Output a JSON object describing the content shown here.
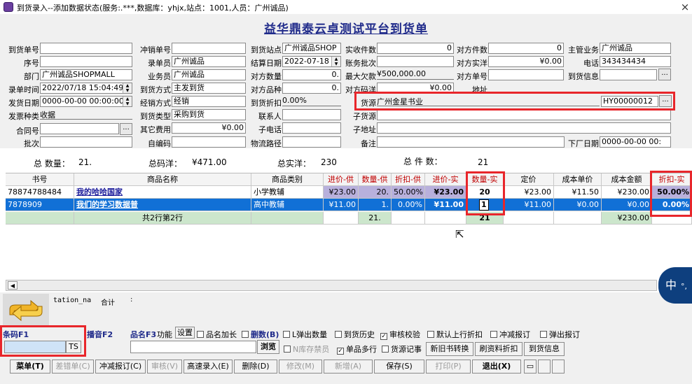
{
  "window": {
    "title": "到货录入--添加数据状态(服务:.***,数据库：yhjx,站点：1001,人员：广州诚品)",
    "close": "×"
  },
  "document_title": "益华鼎泰云卓测试平台到货单",
  "form": {
    "col1": {
      "arrival_no": {
        "label": "到货单号",
        "value": ""
      },
      "seq_no": {
        "label": "序号",
        "value": ""
      },
      "dept": {
        "label": "部门",
        "value": "广州诚品SHOPMALL"
      },
      "entry_time": {
        "label": "录单时间",
        "value": "2022/07/18 15:04:49"
      },
      "ship_date": {
        "label": "发货日期",
        "value": "0000-00-00 00:00:00"
      },
      "invoice_type": {
        "label": "发票种类",
        "value": "收据"
      },
      "contract_no": {
        "label": "合同号",
        "value": ""
      },
      "batch": {
        "label": "批次",
        "value": ""
      }
    },
    "col2": {
      "offset_no": {
        "label": "冲销单号",
        "value": ""
      },
      "entry_clerk": {
        "label": "录单员",
        "value": "广州诚品"
      },
      "salesman": {
        "label": "业务员",
        "value": "广州诚品"
      },
      "arrival_method": {
        "label": "到货方式",
        "value": "主发到货"
      },
      "sale_method": {
        "label": "经销方式",
        "value": "经销"
      },
      "arrival_type": {
        "label": "到货类型",
        "value": "采购到货"
      },
      "other_fee": {
        "label": "其它费用",
        "value": "¥0.00"
      },
      "self_code": {
        "label": "自编码",
        "value": ""
      }
    },
    "col3": {
      "arrival_station": {
        "label": "到货站点",
        "value": "广州诚品SHOP"
      },
      "settle_date": {
        "label": "结算日期",
        "value": "2022-07-18"
      },
      "opp_qty": {
        "label": "对方数量",
        "value": "0."
      },
      "opp_variety": {
        "label": "对方品种",
        "value": "0."
      },
      "arrival_discount": {
        "label": "到货折扣",
        "value": "0.00%"
      },
      "contact": {
        "label": "联系人",
        "value": ""
      },
      "phone": {
        "label": "子电话",
        "value": ""
      },
      "logistics": {
        "label": "物流路径",
        "value": ""
      }
    },
    "col4": {
      "actual_pieces": {
        "label": "实收件数",
        "value": "0"
      },
      "account_batch": {
        "label": "账务批次",
        "value": ""
      },
      "max_owed": {
        "label": "最大欠款",
        "value": "¥500,000.00"
      },
      "opp_marked": {
        "label": "对方码洋",
        "value": "¥0.00"
      },
      "source": {
        "label": "货源",
        "value": "广州金星书业",
        "code": "HY00000012"
      },
      "sub_source": {
        "label": "子货源",
        "value": ""
      },
      "sub_address": {
        "label": "子地址",
        "value": ""
      },
      "remark": {
        "label": "备注",
        "value": ""
      }
    },
    "col5": {
      "opp_pieces": {
        "label": "对方件数",
        "value": "0"
      },
      "opp_actual": {
        "label": "对方实洋",
        "value": "¥0.00"
      },
      "opp_order_no": {
        "label": "对方单号",
        "value": ""
      },
      "address": {
        "label": "地址",
        "value": ""
      }
    },
    "col6": {
      "supervisor": {
        "label": "主管业务",
        "value": "广州诚品"
      },
      "tel": {
        "label": "电话",
        "value": "343434434"
      },
      "arrival_info": {
        "label": "到货信息",
        "value": ""
      },
      "factory_date": {
        "label": "下厂日期",
        "value": "0000-00-00 00:"
      }
    }
  },
  "summary": {
    "total_qty": {
      "label": "总 数量：",
      "value": "21."
    },
    "total_marked": {
      "label": "总码洋：",
      "value": "¥471.00"
    },
    "total_actual": {
      "label": "总实洋：",
      "value": "230"
    },
    "total_pieces": {
      "label": "总 件 数：",
      "value": "21"
    }
  },
  "grid": {
    "columns": [
      "书号",
      "商品名称",
      "商品类别",
      "进价-供",
      "数量-供",
      "折扣-供",
      "进价-实",
      "数量-实",
      "定价",
      "成本单价",
      "成本金额",
      "折扣-实"
    ],
    "rows": [
      [
        "78874788484",
        "我的哈哈国家",
        "小学教辅",
        "¥23.00",
        "20.",
        "50.00%",
        "¥23.00",
        "20",
        "¥23.00",
        "¥11.50",
        "¥230.00",
        "50.00%"
      ],
      [
        "7878909",
        "我们的学习数据普",
        "高中教辅",
        "¥11.00",
        "1.",
        "0.00%",
        "¥11.00",
        "1",
        "¥11.00",
        "¥0.00",
        "¥0.00",
        "0.00%"
      ]
    ],
    "footer": {
      "row_info": "共2行第2行",
      "qty_sup": "21.",
      "qty_act": "21",
      "cost_total": "¥230.00"
    }
  },
  "info_row": {
    "station_label": "tation_na",
    "total_label": "合计",
    "colon": ":"
  },
  "barcode": {
    "label": "条码F1",
    "ts": "TS"
  },
  "voice_label": "播音F2",
  "book_name": {
    "label": "品名F3",
    "function": "功能",
    "settings": "设置"
  },
  "browse": "浏览",
  "checkboxes": [
    {
      "label": "品名加长",
      "checked": false
    },
    {
      "label": "删数(B)",
      "checked": false
    },
    {
      "label": "L弹出数量",
      "checked": false
    },
    {
      "label": "到货历史",
      "checked": true
    },
    {
      "label": "审核校验",
      "checked": true
    },
    {
      "label": "默认上行折扣",
      "checked": false
    },
    {
      "label": "冲减报订",
      "checked": false
    },
    {
      "label": "弹出报订",
      "checked": false
    }
  ],
  "checkboxes2": [
    {
      "label": "N库存禁员",
      "checked": false
    },
    {
      "label": "单品多行",
      "checked": true
    },
    {
      "label": "货源记事",
      "checked": false
    }
  ],
  "side_buttons": [
    "新旧书转换",
    "刷资料折扣",
    "到货信息"
  ],
  "toolbar": [
    "菜单(T)",
    "差错单(C)",
    "冲减报订(C)",
    "审核(V)",
    "高速录入(E)",
    "删除(D)",
    "修改(M)",
    "新增(A)",
    "保存(S)",
    "打印(P)",
    "退出(X)"
  ],
  "ime": {
    "text": "中",
    "extra": "°,"
  }
}
